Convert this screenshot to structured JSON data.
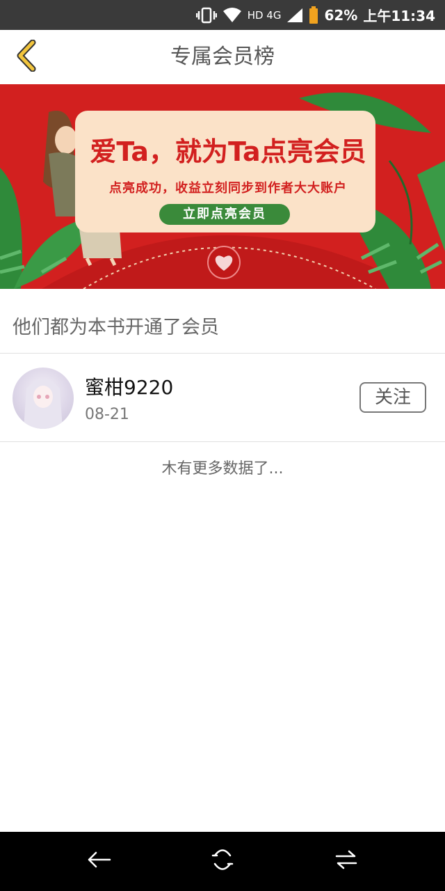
{
  "status_bar": {
    "network": "HD 4G",
    "battery": "62%",
    "time": "上午11:34"
  },
  "header": {
    "title": "专属会员榜",
    "back_icon": "chevron-left-icon",
    "accent": "#f2c53d"
  },
  "banner": {
    "headline": "爱Ta，就为Ta点亮会员",
    "subtitle": "点亮成功，收益立刻同步到作者大大账户",
    "cta_label": "立即点亮会员",
    "background": "#d2201f"
  },
  "section": {
    "title": "他们都为本书开通了会员"
  },
  "members": [
    {
      "name": "蜜柑9220",
      "date": "08-21",
      "follow_label": "关注"
    }
  ],
  "list_footer": "木有更多数据了..."
}
